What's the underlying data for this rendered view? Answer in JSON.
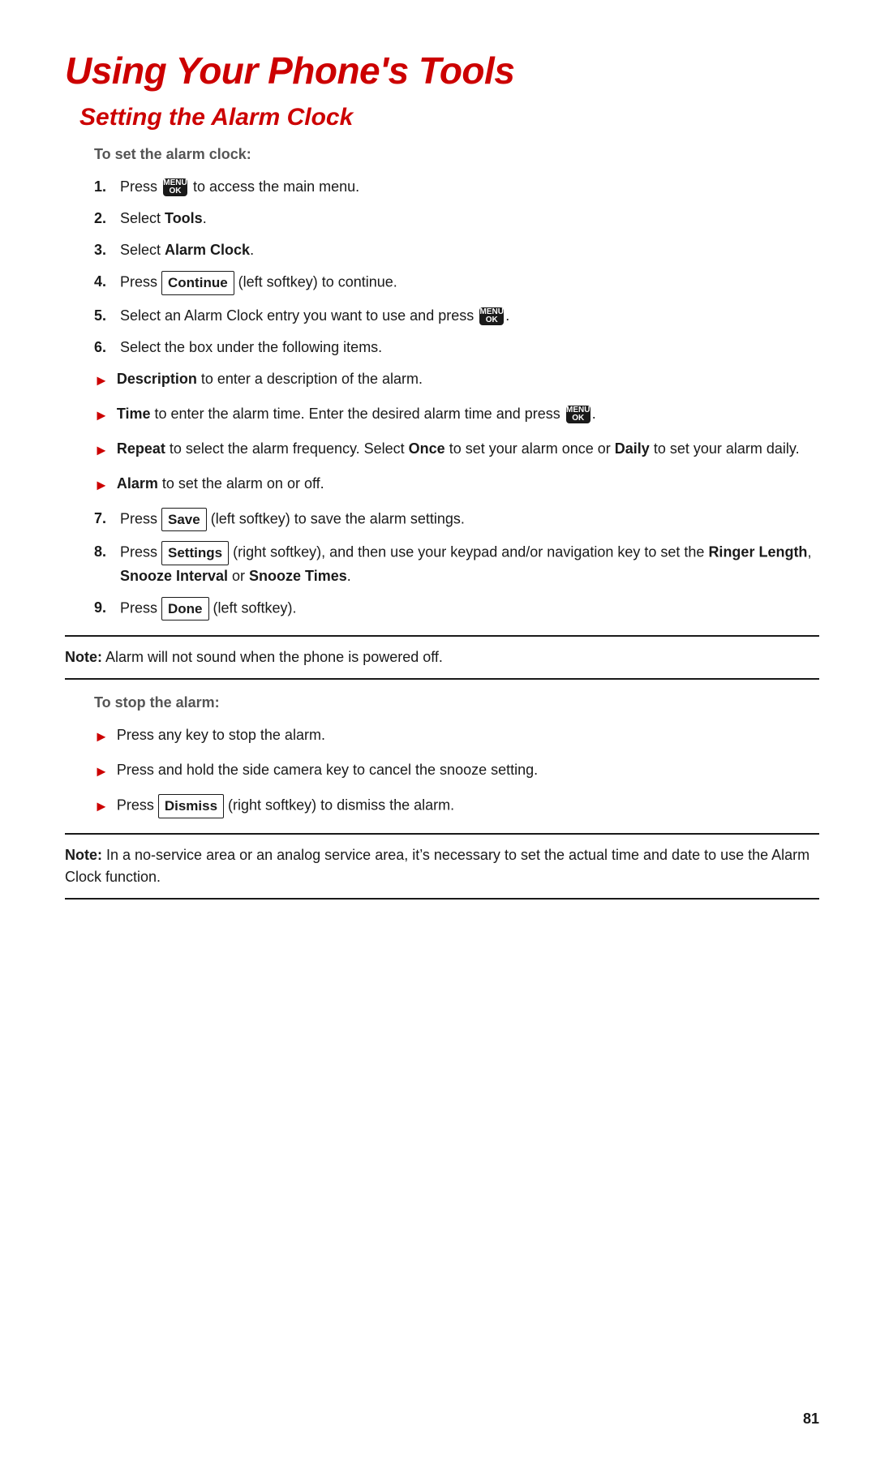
{
  "page": {
    "title": "Using Your Phone's Tools",
    "section": "Setting the Alarm Clock",
    "sub_heading_1": "To set the alarm clock:",
    "sub_heading_2": "To stop the alarm:",
    "page_number": "81"
  },
  "steps": [
    {
      "num": "1.",
      "text_before": "Press ",
      "icon": "MENU\nOK",
      "text_after": " to access the main menu."
    },
    {
      "num": "2.",
      "text_before": "Select ",
      "bold": "Tools",
      "text_after": "."
    },
    {
      "num": "3.",
      "text_before": "Select ",
      "bold": "Alarm Clock",
      "text_after": "."
    },
    {
      "num": "4.",
      "text_before": "Press ",
      "softkey": "Continue",
      "text_after": " (left softkey) to continue."
    },
    {
      "num": "5.",
      "text_before": "Select an Alarm Clock entry you want to use and press ",
      "icon": "MENU\nOK",
      "text_after": "."
    },
    {
      "num": "6.",
      "text_before": "Select the box under the following items.",
      "bold": "",
      "text_after": ""
    },
    {
      "num": "7.",
      "text_before": "Press ",
      "softkey": "Save",
      "text_after": " (left softkey) to save the alarm settings."
    },
    {
      "num": "8.",
      "text_before": "Press ",
      "softkey": "Settings",
      "text_after": " (right softkey), and then use your keypad and/or navigation key to set the ",
      "bold2": "Ringer Length",
      "mid": ", ",
      "bold3": "Snooze Interval",
      "end": " or ",
      "bold4": "Snooze Times",
      "period": "."
    },
    {
      "num": "9.",
      "text_before": "Press ",
      "softkey": "Done",
      "text_after": " (left softkey)."
    }
  ],
  "bullets_set": [
    {
      "bold": "Description",
      "text": " to enter a description of the alarm."
    },
    {
      "bold": "Time",
      "text": " to enter the alarm time. Enter the desired alarm time and press ",
      "has_icon": true,
      "text_after": "."
    },
    {
      "bold": "Repeat",
      "text": " to select the alarm frequency. Select ",
      "bold2": "Once",
      "mid": " to set your alarm once or ",
      "bold3": "Daily",
      "end": " to set your alarm daily."
    },
    {
      "bold": "Alarm",
      "text": " to set the alarm on or off."
    }
  ],
  "stop_bullets": [
    {
      "text": "Press any key to stop the alarm."
    },
    {
      "text": "Press and hold the side camera key to cancel the snooze setting."
    },
    {
      "text": "Press ",
      "softkey": "Dismiss",
      "text_after": " (right softkey) to dismiss the alarm."
    }
  ],
  "note1": {
    "label": "Note:",
    "text": " Alarm will not sound when the phone is powered off."
  },
  "note2": {
    "label": "Note:",
    "text": " In a no-service area or an analog service area, it’s necessary to set the actual time and date to use the Alarm Clock function."
  },
  "icons": {
    "menu_ok": "MENU\nOK",
    "arrow": "►"
  }
}
